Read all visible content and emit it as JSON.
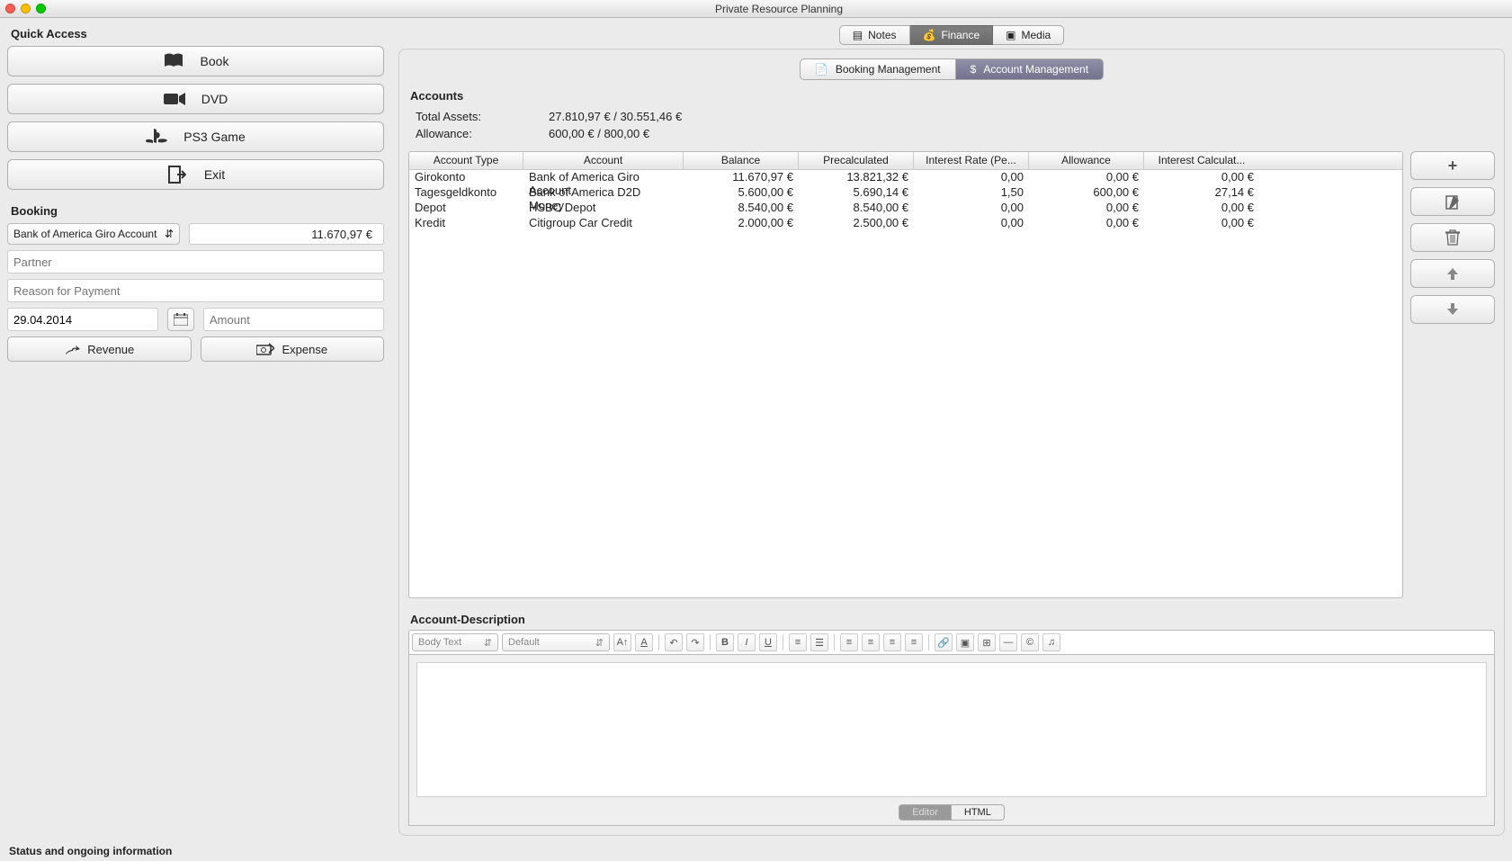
{
  "window": {
    "title": "Private Resource Planning"
  },
  "quick_access": {
    "label": "Quick Access",
    "book": "Book",
    "dvd": "DVD",
    "ps3": "PS3 Game",
    "exit": "Exit"
  },
  "booking": {
    "label": "Booking",
    "account_selected": "Bank of America Giro Account",
    "account_balance": "11.670,97 €",
    "partner_placeholder": "Partner",
    "reason_placeholder": "Reason for Payment",
    "date": "29.04.2014",
    "amount_placeholder": "Amount",
    "revenue": "Revenue",
    "expense": "Expense"
  },
  "top_tabs": {
    "notes": "Notes",
    "finance": "Finance",
    "media": "Media"
  },
  "sub_tabs": {
    "booking_mgmt": "Booking Management",
    "account_mgmt": "Account Management"
  },
  "accounts": {
    "label": "Accounts",
    "total_assets_label": "Total Assets:",
    "total_assets_value": "27.810,97 €  /  30.551,46 €",
    "allowance_label": "Allowance:",
    "allowance_value": "600,00 €  /  800,00 €",
    "columns": {
      "type": "Account Type",
      "account": "Account",
      "balance": "Balance",
      "precalc": "Precalculated",
      "interest_rate": "Interest Rate (Pe...",
      "allowance": "Allowance",
      "interest_calc": "Interest Calculat..."
    },
    "rows": [
      {
        "type": "Girokonto",
        "account": "Bank of America Giro Account",
        "balance": "11.670,97 €",
        "precalc": "13.821,32 €",
        "interest": "0,00",
        "allowance": "0,00 €",
        "interest_calc": "0,00 €"
      },
      {
        "type": "Tagesgeldkonto",
        "account": "Bank of America D2D Money",
        "balance": "5.600,00 €",
        "precalc": "5.690,14 €",
        "interest": "1,50",
        "allowance": "600,00 €",
        "interest_calc": "27,14 €"
      },
      {
        "type": "Depot",
        "account": "HSBC Depot",
        "balance": "8.540,00 €",
        "precalc": "8.540,00 €",
        "interest": "0,00",
        "allowance": "0,00 €",
        "interest_calc": "0,00 €"
      },
      {
        "type": "Kredit",
        "account": "Citigroup Car Credit",
        "balance": "2.000,00 €",
        "precalc": "2.500,00 €",
        "interest": "0,00",
        "allowance": "0,00 €",
        "interest_calc": "0,00 €"
      }
    ]
  },
  "description": {
    "label": "Account-Description",
    "style": "Body Text",
    "font": "Default",
    "editor_tab": "Editor",
    "html_tab": "HTML"
  },
  "status": "Status and ongoing information"
}
